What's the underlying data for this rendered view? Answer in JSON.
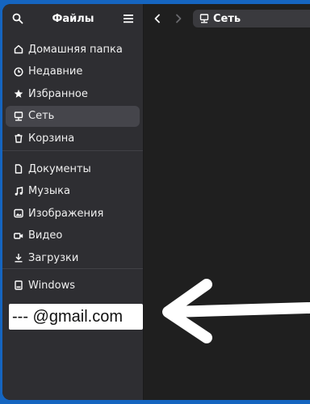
{
  "sidebar": {
    "title": "Файлы",
    "places": [
      {
        "label": "Домашняя папка",
        "icon": "home-icon"
      },
      {
        "label": "Недавние",
        "icon": "clock-icon"
      },
      {
        "label": "Избранное",
        "icon": "star-icon"
      },
      {
        "label": "Сеть",
        "icon": "network-icon",
        "active": true
      },
      {
        "label": "Корзина",
        "icon": "trash-icon"
      }
    ],
    "bookmarks": [
      {
        "label": "Документы",
        "icon": "document-icon"
      },
      {
        "label": "Музыка",
        "icon": "music-icon"
      },
      {
        "label": "Изображения",
        "icon": "image-icon"
      },
      {
        "label": "Видео",
        "icon": "video-icon"
      },
      {
        "label": "Загрузки",
        "icon": "download-icon"
      }
    ],
    "devices": [
      {
        "label": "Windows",
        "icon": "drive-icon"
      }
    ],
    "overlay_email": "--- @gmail.com"
  },
  "main": {
    "path_label": "Сеть",
    "path_icon": "network-icon"
  },
  "colors": {
    "desktop": "#1565c0",
    "sidebar_bg": "#2e2e32",
    "content_bg": "#1f1f1f",
    "active_item": "#45454b",
    "annotation_arrow": "#ffffff"
  }
}
